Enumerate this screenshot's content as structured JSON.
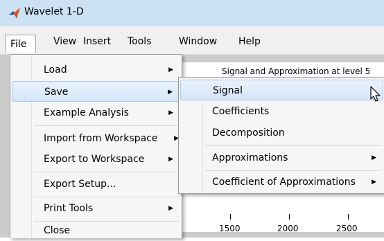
{
  "window": {
    "title": "Wavelet 1-D"
  },
  "menubar": [
    "File",
    "View",
    "Insert",
    "Tools",
    "Window",
    "Help"
  ],
  "file_menu": [
    {
      "label": "Load",
      "submenu": true
    },
    {
      "label": "Save",
      "submenu": true
    },
    {
      "label": "Example Analysis",
      "submenu": true
    },
    {
      "label": "Import from Workspace",
      "submenu": true
    },
    {
      "label": "Export to Workspace",
      "submenu": true
    },
    {
      "label": "Export Setup...",
      "submenu": false
    },
    {
      "label": "Print Tools",
      "submenu": true
    },
    {
      "label": "Close",
      "submenu": false
    }
  ],
  "save_menu": [
    {
      "label": "Signal",
      "submenu": false
    },
    {
      "label": "Coefficients",
      "submenu": false
    },
    {
      "label": "Decomposition",
      "submenu": false
    },
    {
      "label": "Approximations",
      "submenu": true
    },
    {
      "label": "Coefficient of Approximations",
      "submenu": true
    }
  ],
  "figure": {
    "title": "Signal and Approximation at level 5",
    "x_ticks": [
      "1500",
      "2000",
      "2500"
    ]
  },
  "colors": {
    "titlebar": "#cde1f4",
    "menu_highlight": "#d5e6f8",
    "figure_bg": "#cccccc"
  },
  "icons": {
    "submenu_arrow": "▶",
    "app": "matlab-logo-icon",
    "pointer": "mouse-pointer-icon"
  }
}
